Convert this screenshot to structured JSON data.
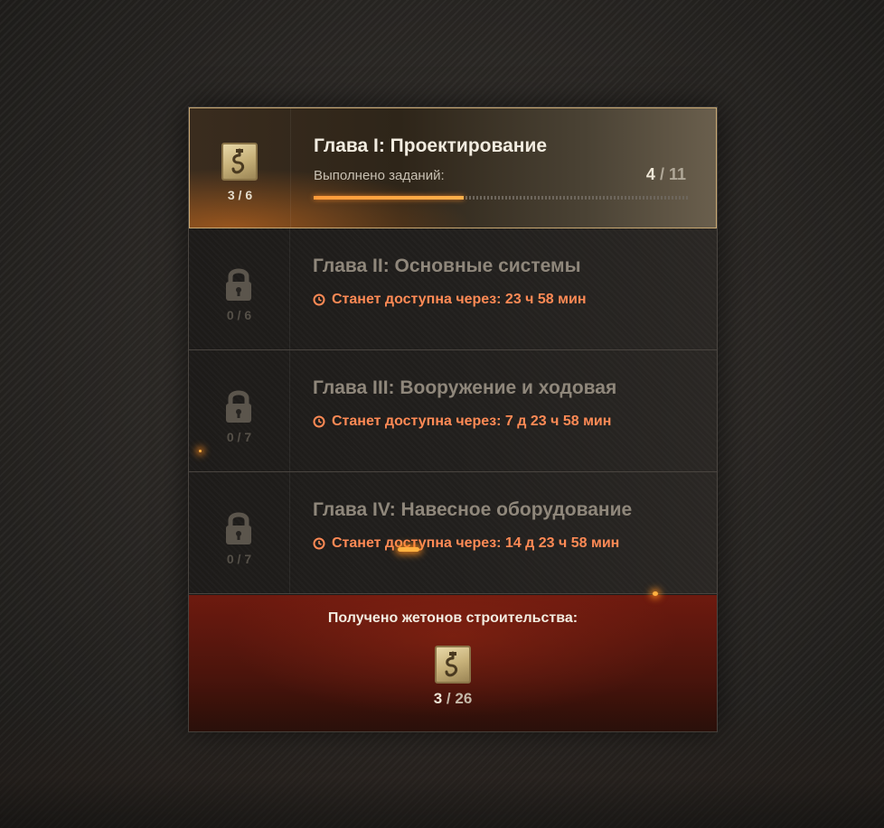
{
  "chapters": [
    {
      "title": "Глава I: Проектирование",
      "state": "active",
      "tokens": "3 / 6",
      "progress_label": "Выполнено заданий:",
      "progress_done": "4",
      "progress_sep": "/",
      "progress_total": "11",
      "progress_fraction": 0.4
    },
    {
      "title": "Глава II: Основные системы",
      "state": "locked",
      "tokens": "0 / 6",
      "timer": "Станет доступна через: 23 ч 58 мин"
    },
    {
      "title": "Глава III: Вооружение и ходовая",
      "state": "locked",
      "tokens": "0 / 7",
      "timer": "Станет доступна через: 7 д 23 ч 58 мин"
    },
    {
      "title": "Глава IV: Навесное оборудование",
      "state": "locked",
      "tokens": "0 / 7",
      "timer": "Станет доступна через: 14 д 23 ч 58 мин"
    }
  ],
  "summary": {
    "title": "Получено жетонов строительства:",
    "current": "3",
    "sep": "/",
    "total": "26"
  },
  "icons": {
    "token": "construction-token-icon",
    "lock": "lock-icon",
    "timer": "clock-icon"
  },
  "colors": {
    "accent_orange": "#ff9a3a",
    "timer_red": "#ff8a55",
    "summary_red": "#6e1a0f"
  }
}
